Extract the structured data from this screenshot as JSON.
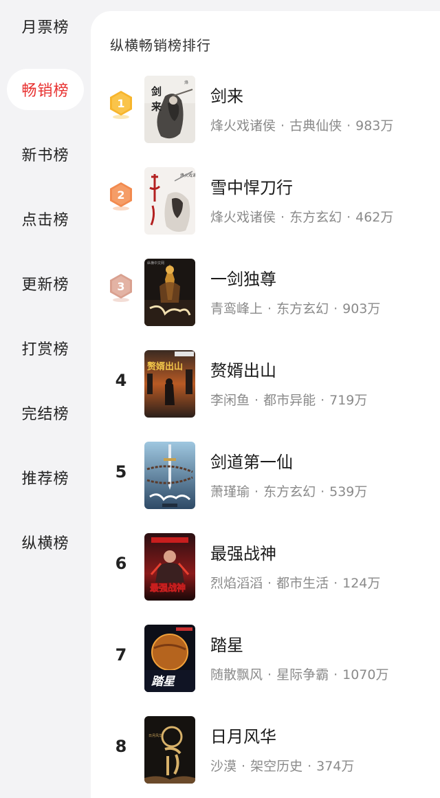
{
  "sidebar": {
    "items": [
      {
        "label": "月票榜"
      },
      {
        "label": "畅销榜"
      },
      {
        "label": "新书榜"
      },
      {
        "label": "点击榜"
      },
      {
        "label": "更新榜"
      },
      {
        "label": "打赏榜"
      },
      {
        "label": "完结榜"
      },
      {
        "label": "推荐榜"
      },
      {
        "label": "纵横榜"
      }
    ],
    "active_index": 1
  },
  "main": {
    "title": "纵横畅销榜排行",
    "books": [
      {
        "rank": "1",
        "title": "剑来",
        "author": "烽火戏诸侯",
        "genre": "古典仙侠",
        "count": "983万",
        "cover_icon": "ink-swordsman-cover"
      },
      {
        "rank": "2",
        "title": "雪中悍刀行",
        "author": "烽火戏诸侯",
        "genre": "东方玄幻",
        "count": "462万",
        "cover_icon": "calligraphy-swordsman-cover"
      },
      {
        "rank": "3",
        "title": "一剑独尊",
        "author": "青鸾峰上",
        "genre": "东方玄幻",
        "count": "903万",
        "cover_icon": "golden-throne-cover"
      },
      {
        "rank": "4",
        "title": "赘婿出山",
        "author": "李闲鱼",
        "genre": "都市异能",
        "count": "719万",
        "cover_icon": "city-fire-cover"
      },
      {
        "rank": "5",
        "title": "剑道第一仙",
        "author": "萧瑾瑜",
        "genre": "东方玄幻",
        "count": "539万",
        "cover_icon": "chained-sword-cover"
      },
      {
        "rank": "6",
        "title": "最强战神",
        "author": "烈焰滔滔",
        "genre": "都市生活",
        "count": "124万",
        "cover_icon": "red-warrior-cover"
      },
      {
        "rank": "7",
        "title": "踏星",
        "author": "随散飘风",
        "genre": "星际争霸",
        "count": "1070万",
        "cover_icon": "planet-cover"
      },
      {
        "rank": "8",
        "title": "日月风华",
        "author": "沙漠",
        "genre": "架空历史",
        "count": "374万",
        "cover_icon": "dark-calligraphy-cover"
      }
    ]
  },
  "colors": {
    "active_tab": "#e8302f",
    "gold_badge": "#f7b52c",
    "orange_badge": "#f28a4e",
    "bronze_badge": "#d9a08f"
  }
}
